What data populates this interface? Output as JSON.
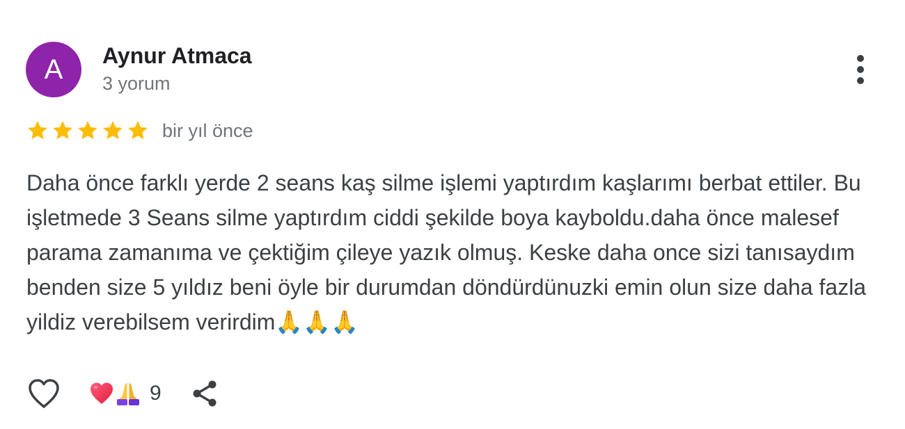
{
  "review": {
    "author": {
      "initial": "A",
      "name": "Aynur Atmaca",
      "review_count_label": "3 yorum",
      "avatar_color": "#8e24aa"
    },
    "rating": {
      "stars": 5,
      "max_stars": 5,
      "star_color": "#fbbc04"
    },
    "date_label": "bir yıl önce",
    "text": "Daha önce farklı yerde 2 seans kaş silme işlemi yaptırdım kaşlarımı berbat ettiler. Bu işletmede 3 Seans silme yaptırdım ciddi şekilde boya kayboldu.daha önce malesef parama zamanıma ve çektiğim çileye yazık olmuş. Keske daha once sizi tanısaydım benden size 5 yıldız beni öyle bir durumdan döndürdünuzki emin olun size daha fazla yildiz verebilsem verirdim",
    "text_emoji": "🙏🙏🙏",
    "menu_icon": "more-vert-icon"
  },
  "actions": {
    "like_icon": "heart-outline-icon",
    "reactions": {
      "icons": [
        "heart-emoji-icon",
        "folded-hands-emoji-icon"
      ],
      "count": "9"
    },
    "share_icon": "share-icon"
  }
}
